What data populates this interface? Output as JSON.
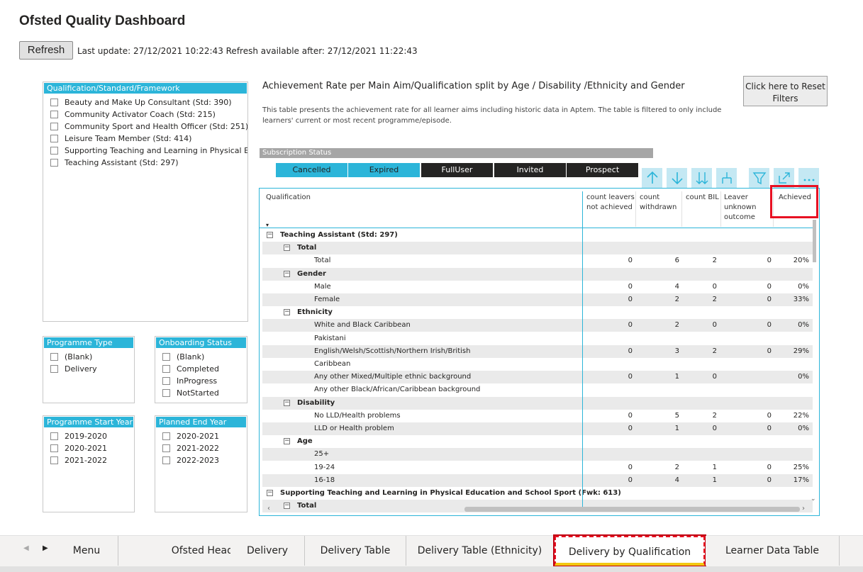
{
  "header": {
    "title": "Ofsted Quality Dashboard",
    "refresh_label": "Refresh",
    "last_update": "Last update: 27/12/2021 10:22:43 Refresh available after: 27/12/2021 11:22:43"
  },
  "slicers": {
    "qualification": {
      "title": "Qualification/Standard/Framework",
      "items": [
        "Beauty and Make Up Consultant (Std: 390)",
        "Community Activator Coach (Std: 215)",
        "Community Sport and Health Officer (Std: 251)",
        "Leisure Team Member (Std: 414)",
        "Supporting Teaching and Learning in Physical E...",
        "Teaching Assistant (Std: 297)"
      ]
    },
    "programme_type": {
      "title": "Programme Type",
      "items": [
        "(Blank)",
        "Delivery"
      ]
    },
    "onboarding_status": {
      "title": "Onboarding Status",
      "items": [
        "(Blank)",
        "Completed",
        "InProgress",
        "NotStarted"
      ]
    },
    "programme_start_year": {
      "title": "Programme Start Year",
      "items": [
        "2019-2020",
        "2020-2021",
        "2021-2022"
      ]
    },
    "planned_end_year": {
      "title": "Planned End Year",
      "items": [
        "2020-2021",
        "2021-2022",
        "2022-2023"
      ]
    }
  },
  "report": {
    "title": "Achievement Rate per Main Aim/Qualification split by Age / Disability /Ethnicity and Gender",
    "description": "This table presents the achievement rate for all learner aims including historic data in Aptem.  The table is filtered to only include learners' current or most recent programme/episode.",
    "reset_button": "Click here to Reset Filters"
  },
  "subscription": {
    "title": "Subscription Status",
    "buttons": [
      {
        "label": "Cancelled",
        "state": "selected"
      },
      {
        "label": "Expired",
        "state": "selected"
      },
      {
        "label": "FullUser",
        "state": "unselected"
      },
      {
        "label": "Invited",
        "state": "unselected"
      },
      {
        "label": "Prospect",
        "state": "unselected"
      }
    ]
  },
  "toolbar": {
    "icons": [
      "drill-up-icon",
      "drill-down-icon",
      "expand-next-level-icon",
      "expand-hierarchy-icon",
      "filter-icon",
      "focus-mode-icon",
      "more-options-icon"
    ]
  },
  "table": {
    "columns": {
      "qualification": "Qualification",
      "c1": "count leavers not achieved",
      "c2": "count withdrawn",
      "c3": "count BIL",
      "c4": "Leaver unknown outcome",
      "c5": "Achieved"
    },
    "rows": [
      {
        "label": "Teaching Assistant (Std: 297)",
        "level": 0,
        "bold": true,
        "toggle": "−",
        "values": [
          "",
          "",
          "",
          "",
          ""
        ]
      },
      {
        "label": "Total",
        "level": 1,
        "bold": true,
        "toggle": "−",
        "values": [
          "",
          "",
          "",
          "",
          ""
        ]
      },
      {
        "label": "Total",
        "level": 2,
        "bold": false,
        "toggle": "",
        "values": [
          "0",
          "6",
          "2",
          "0",
          "20%"
        ]
      },
      {
        "label": "Gender",
        "level": 1,
        "bold": true,
        "toggle": "−",
        "values": [
          "",
          "",
          "",
          "",
          ""
        ]
      },
      {
        "label": "Male",
        "level": 2,
        "bold": false,
        "toggle": "",
        "values": [
          "0",
          "4",
          "0",
          "0",
          "0%"
        ]
      },
      {
        "label": "Female",
        "level": 2,
        "bold": false,
        "toggle": "",
        "values": [
          "0",
          "2",
          "2",
          "0",
          "33%"
        ]
      },
      {
        "label": "Ethnicity",
        "level": 1,
        "bold": true,
        "toggle": "−",
        "values": [
          "",
          "",
          "",
          "",
          ""
        ]
      },
      {
        "label": "White and Black Caribbean",
        "level": 2,
        "bold": false,
        "toggle": "",
        "values": [
          "0",
          "2",
          "0",
          "0",
          "0%"
        ]
      },
      {
        "label": "Pakistani",
        "level": 2,
        "bold": false,
        "toggle": "",
        "values": [
          "",
          "",
          "",
          "",
          ""
        ]
      },
      {
        "label": "English/Welsh/Scottish/Northern Irish/British",
        "level": 2,
        "bold": false,
        "toggle": "",
        "values": [
          "0",
          "3",
          "2",
          "0",
          "29%"
        ]
      },
      {
        "label": "Caribbean",
        "level": 2,
        "bold": false,
        "toggle": "",
        "values": [
          "",
          "",
          "",
          "",
          ""
        ]
      },
      {
        "label": "Any other Mixed/Multiple ethnic background",
        "level": 2,
        "bold": false,
        "toggle": "",
        "values": [
          "0",
          "1",
          "0",
          "",
          "0%"
        ]
      },
      {
        "label": "Any other Black/African/Caribbean background",
        "level": 2,
        "bold": false,
        "toggle": "",
        "values": [
          "",
          "",
          "",
          "",
          ""
        ]
      },
      {
        "label": "Disability",
        "level": 1,
        "bold": true,
        "toggle": "−",
        "values": [
          "",
          "",
          "",
          "",
          ""
        ]
      },
      {
        "label": "No LLD/Health problems",
        "level": 2,
        "bold": false,
        "toggle": "",
        "values": [
          "0",
          "5",
          "2",
          "0",
          "22%"
        ]
      },
      {
        "label": "LLD or Health problem",
        "level": 2,
        "bold": false,
        "toggle": "",
        "values": [
          "0",
          "1",
          "0",
          "0",
          "0%"
        ]
      },
      {
        "label": "Age",
        "level": 1,
        "bold": true,
        "toggle": "−",
        "values": [
          "",
          "",
          "",
          "",
          ""
        ]
      },
      {
        "label": "25+",
        "level": 2,
        "bold": false,
        "toggle": "",
        "values": [
          "",
          "",
          "",
          "",
          ""
        ]
      },
      {
        "label": "19-24",
        "level": 2,
        "bold": false,
        "toggle": "",
        "values": [
          "0",
          "2",
          "1",
          "0",
          "25%"
        ]
      },
      {
        "label": "16-18",
        "level": 2,
        "bold": false,
        "toggle": "",
        "values": [
          "0",
          "4",
          "1",
          "0",
          "17%"
        ]
      },
      {
        "label": "Supporting Teaching and Learning in Physical Education and School Sport (Fwk: 613)",
        "level": 0,
        "bold": true,
        "toggle": "−",
        "values": [
          "",
          "",
          "",
          "",
          ""
        ]
      },
      {
        "label": "Total",
        "level": 1,
        "bold": true,
        "toggle": "−",
        "values": [
          "",
          "",
          "",
          "",
          ""
        ]
      }
    ]
  },
  "tabs": [
    {
      "label": "Menu",
      "active": false
    },
    {
      "label": "Ofsted Headline",
      "active": false
    },
    {
      "label": "Delivery",
      "active": false
    },
    {
      "label": "Delivery Table",
      "active": false
    },
    {
      "label": "Delivery Table (Ethnicity)",
      "active": false
    },
    {
      "label": "Delivery by Qualification",
      "active": true
    },
    {
      "label": "Learner Data Table",
      "active": false
    }
  ],
  "colors": {
    "accent": "#2cb5d9",
    "highlight": "#e81123",
    "dark_button": "#252423"
  }
}
